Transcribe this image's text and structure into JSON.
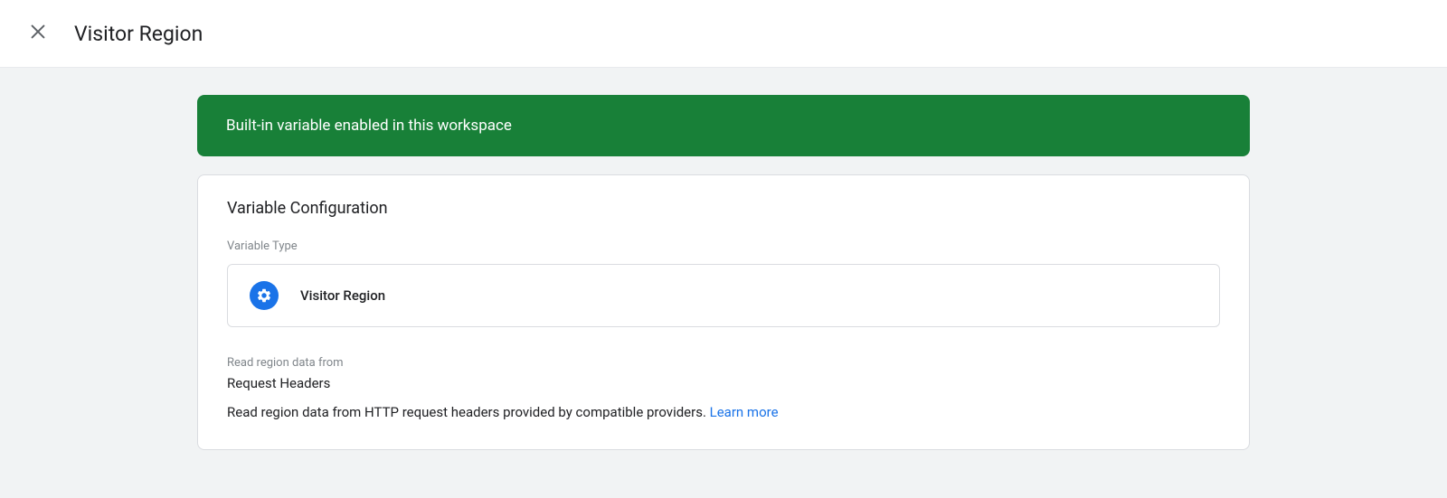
{
  "header": {
    "title": "Visitor Region"
  },
  "banner": {
    "text": "Built-in variable enabled in this workspace"
  },
  "card": {
    "title": "Variable Configuration",
    "variable_type_label": "Variable Type",
    "variable_type_value": "Visitor Region",
    "read_region_label": "Read region data from",
    "read_region_value": "Request Headers",
    "description": "Read region data from HTTP request headers provided by compatible providers. ",
    "learn_more": "Learn more"
  }
}
